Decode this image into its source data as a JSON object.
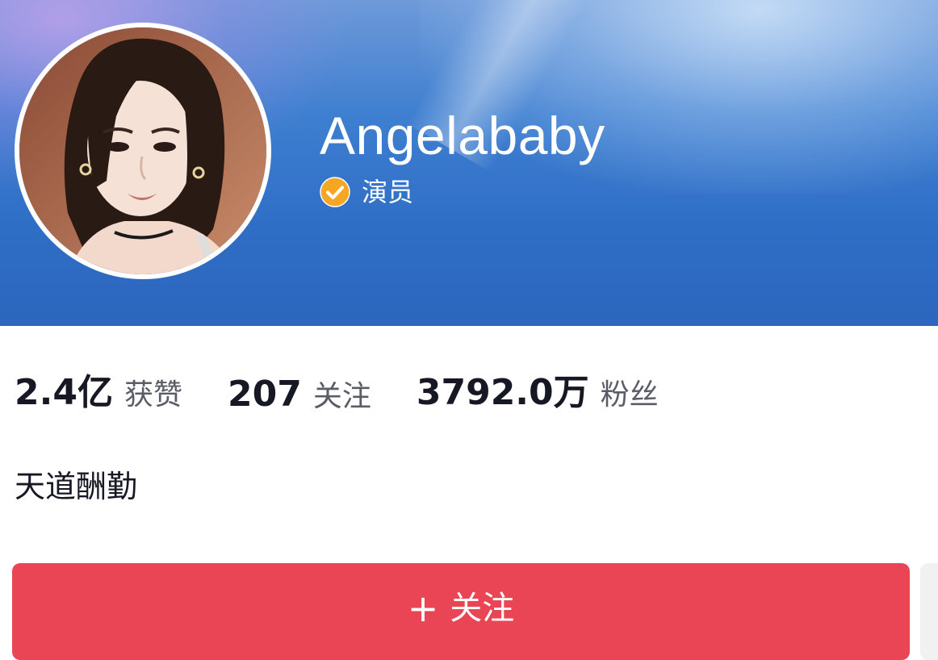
{
  "profile": {
    "name": "Angelababy",
    "verify_label": "演员",
    "bio": "天道酬勤"
  },
  "stats": [
    {
      "value": "2.4亿",
      "label": "获赞"
    },
    {
      "value": "207",
      "label": "关注"
    },
    {
      "value": "3792.0万",
      "label": "粉丝"
    }
  ],
  "follow_button": {
    "icon": "+",
    "label": "关注"
  },
  "icons": {
    "verified": "verified-badge-icon",
    "avatar": "avatar-photo"
  },
  "colors": {
    "header_blue": "#2f6ec6",
    "badge_orange": "#f5a623",
    "follow_red": "#e94554",
    "text_dark": "#161823",
    "text_gray": "#5a5c66"
  }
}
